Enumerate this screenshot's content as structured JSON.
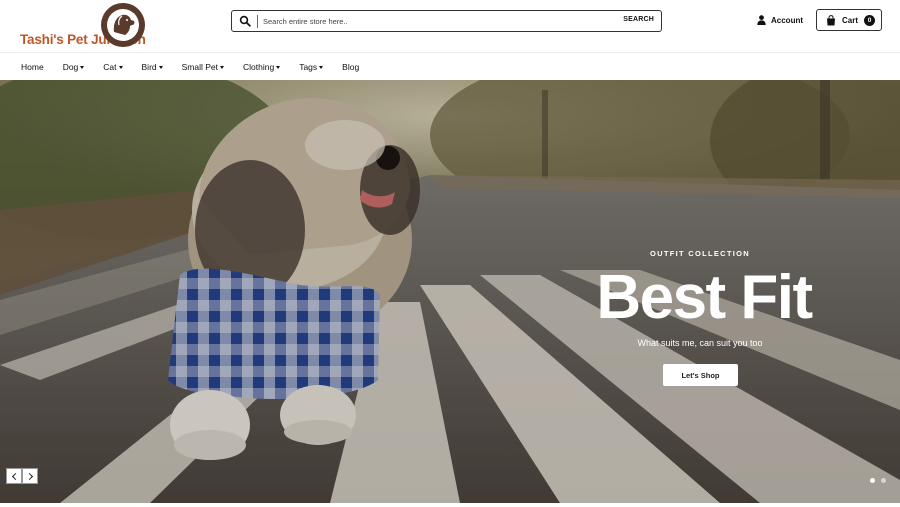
{
  "brand": {
    "name": "Tashi's Pet Junction",
    "color": "#c2562a",
    "mark_color": "#5a3a2a"
  },
  "search": {
    "placeholder": "Search entire store here..",
    "value": "",
    "button_label": "SEARCH",
    "icon": "search-icon"
  },
  "account": {
    "label": "Account",
    "icon": "user-icon"
  },
  "cart": {
    "label": "Cart",
    "count": "0",
    "icon": "shopping-bag-icon"
  },
  "nav": {
    "items": [
      {
        "label": "Home",
        "dropdown": false
      },
      {
        "label": "Dog",
        "dropdown": true
      },
      {
        "label": "Cat",
        "dropdown": true
      },
      {
        "label": "Bird",
        "dropdown": true
      },
      {
        "label": "Small Pet",
        "dropdown": true
      },
      {
        "label": "Clothing",
        "dropdown": true
      },
      {
        "label": "Tags",
        "dropdown": true
      },
      {
        "label": "Blog",
        "dropdown": false
      }
    ]
  },
  "hero": {
    "kicker": "OUTFIT COLLECTION",
    "title": "Best Fit",
    "subtitle": "What suits me, can suit you too",
    "cta_label": "Let's Shop",
    "prev_icon": "chevron-left-icon",
    "next_icon": "chevron-right-icon",
    "slide_count": 2,
    "active_slide": 1
  }
}
